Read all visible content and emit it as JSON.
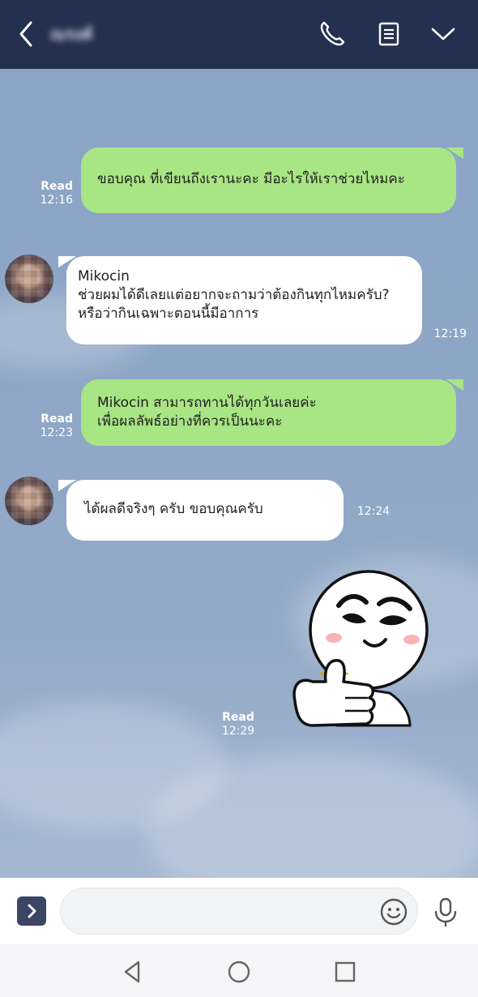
{
  "header": {
    "contact_name": "ณรงค์"
  },
  "messages": [
    {
      "direction": "out",
      "text": "ขอบคุณ ที่เขียนถึงเรานะคะ มีอะไรให้เราช่วยไหมคะ",
      "status": "Read",
      "time": "12:16"
    },
    {
      "direction": "in",
      "sender": "Mikocin",
      "lines": [
        "ช่วยผมได้ดีเลยแต่อยากจะถามว่าต้องกินทุกไหมครับ?",
        "หรือว่ากินเฉพาะตอนนี้มีอาการ"
      ],
      "time": "12:19"
    },
    {
      "direction": "out",
      "lines": [
        "Mikocin สามารถทานได้ทุกวันเลยค่ะ",
        "เพื่อผลลัพธ์อย่างที่ควรเป็นนะคะ"
      ],
      "status": "Read",
      "time": "12:23"
    },
    {
      "direction": "in",
      "text": "ได้ผลดีจริงๆ ครับ ขอบคุณครับ",
      "time": "12:24"
    },
    {
      "direction": "out",
      "type": "sticker",
      "sticker": "moon-thumbs-up-sticker",
      "status": "Read",
      "time": "12:29"
    }
  ],
  "input": {
    "value": "",
    "placeholder": ""
  },
  "colors": {
    "header_bg": "#23304f",
    "outgoing_bubble": "#a8e584",
    "incoming_bubble": "#ffffff",
    "chat_bg": "#8ba4c6"
  }
}
